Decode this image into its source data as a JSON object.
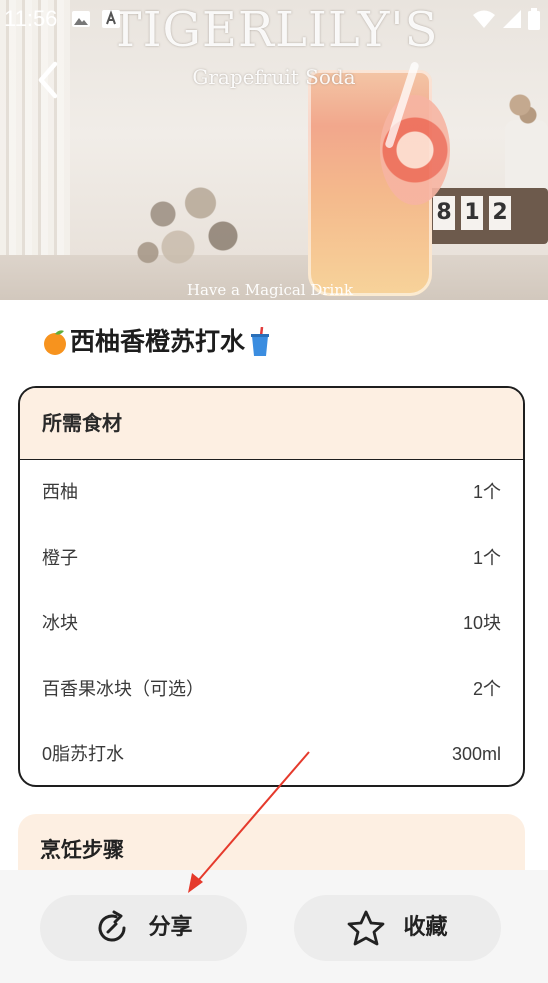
{
  "status_bar": {
    "time": "11:56",
    "left_icons": [
      "image-icon",
      "notification-a-icon"
    ],
    "right_icons": [
      "wifi-icon",
      "signal-icon",
      "battery-icon"
    ]
  },
  "hero": {
    "title": "TIGERLILY'S",
    "subtitle": "Grapefruit Soda",
    "tagline": "Have a Magical Drink",
    "calendar_digits": [
      "8",
      "1",
      "2"
    ]
  },
  "recipe": {
    "title": "西柚香橙苏打水",
    "leading_emoji": "orange-icon",
    "trailing_emoji": "cup-with-straw-icon"
  },
  "ingredients": {
    "header": "所需食材",
    "items": [
      {
        "name": "西柚",
        "amount": "1个"
      },
      {
        "name": "橙子",
        "amount": "1个"
      },
      {
        "name": "冰块",
        "amount": "10块"
      },
      {
        "name": "百香果冰块（可选）",
        "amount": "2个"
      },
      {
        "name": "0脂苏打水",
        "amount": "300ml"
      }
    ]
  },
  "steps": {
    "header": "烹饪步骤"
  },
  "actions": {
    "share_label": "分享",
    "favorite_label": "收藏"
  },
  "colors": {
    "card_header_bg": "#fdefe2",
    "button_bg": "#ececec",
    "arrow": "#e53a2c"
  }
}
